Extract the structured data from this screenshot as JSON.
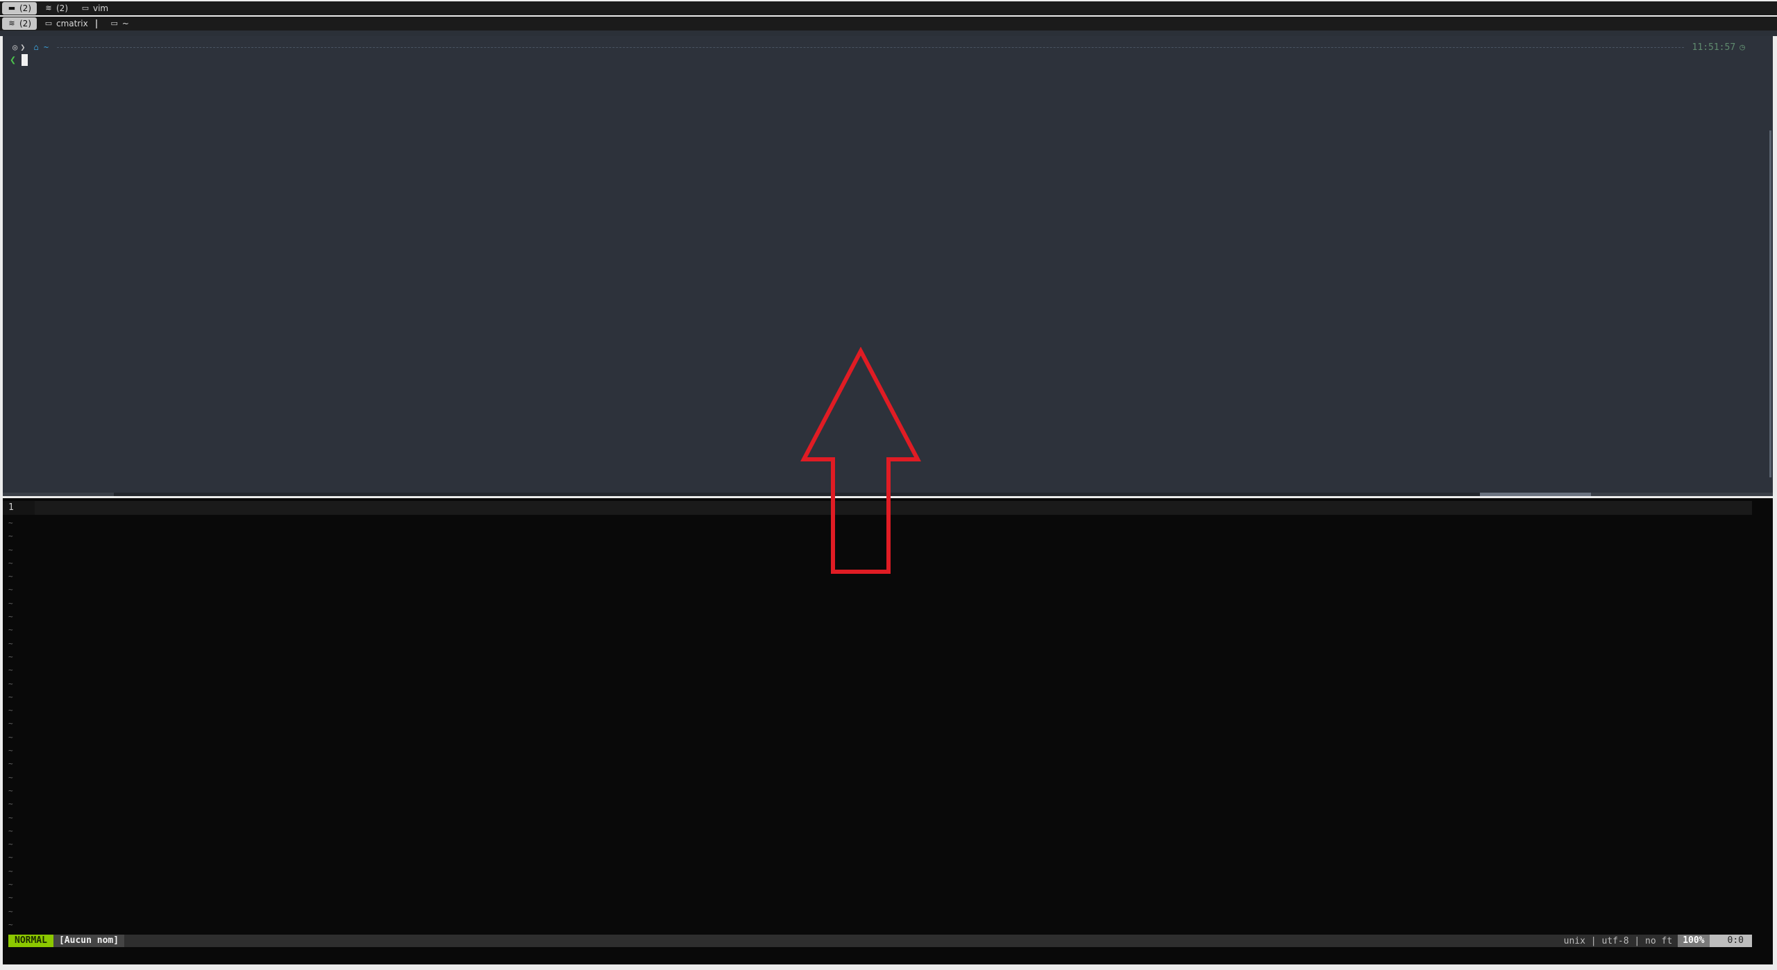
{
  "top_tabs": [
    {
      "icon": "window-icon",
      "label": "(2)",
      "active": true
    },
    {
      "icon": "layers-icon",
      "label": "(2)",
      "active": false
    },
    {
      "icon": "terminal-icon",
      "label": "vim",
      "active": false
    }
  ],
  "second_tabs": [
    {
      "icon": "layers-icon",
      "label": "(2)",
      "active": true
    },
    {
      "icon": "terminal-icon",
      "label": "cmatrix",
      "active": false
    },
    {
      "icon": "terminal-icon",
      "label": "~",
      "active": false
    }
  ],
  "terminal": {
    "prompt_dir": "~",
    "clock": "11:51:57",
    "prompt_char": "❮"
  },
  "vim": {
    "line_number": "1",
    "mode": "NORMAL",
    "filename": "[Aucun nom]",
    "info": "unix | utf-8 | no ft",
    "percent": "100%",
    "position": "0:0",
    "tilde": "~"
  },
  "colors": {
    "mode_bg": "#8cc800",
    "arrow": "#e01c24",
    "terminal_bg": "#2d323b",
    "vim_bg": "#090909"
  }
}
